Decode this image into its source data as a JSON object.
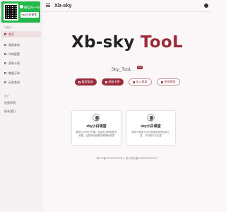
{
  "promo": {
    "title": "微信扫一扫",
    "id_text": "sky小白课堂"
  },
  "sidebar": {
    "section_1": "功能区",
    "items": [
      {
        "label": "首页"
      },
      {
        "label": "备案查询"
      },
      {
        "label": "中转配置"
      },
      {
        "label": "获取卡密"
      },
      {
        "label": "数据订单"
      },
      {
        "label": "历史查询"
      }
    ],
    "section_2": "其它",
    "links": [
      {
        "label": "免责声明"
      },
      {
        "label": "联系我们"
      }
    ]
  },
  "header": {
    "title": "Xb-sky"
  },
  "hero": {
    "title_main": "Xb-sky",
    "title_accent": "TooL",
    "subtitle": "Sky_TooL",
    "version": "2.0"
  },
  "buttons": [
    {
      "label": "备案查询"
    },
    {
      "label": "获取卡密"
    },
    {
      "label": "加入群组"
    },
    {
      "label": "使用教程"
    }
  ],
  "cards": [
    {
      "title": "sky小白课堂",
      "desc": "微信公众号已开通，欢迎关注获取更多资源，这里有你想要的教程和资源"
    },
    {
      "title": "sky小白课堂",
      "desc": "微信小程序可以在线使用快速查询工具，不用再打开这里"
    }
  ],
  "footer": {
    "text": "粤ICP备2023025000号-1 粤公网安备44030502001170"
  },
  "colors": {
    "accent": "#9b2c3c",
    "wechat_green": "#22b84a"
  },
  "icons": {
    "menu": "menu-icon",
    "github": "github-icon"
  }
}
